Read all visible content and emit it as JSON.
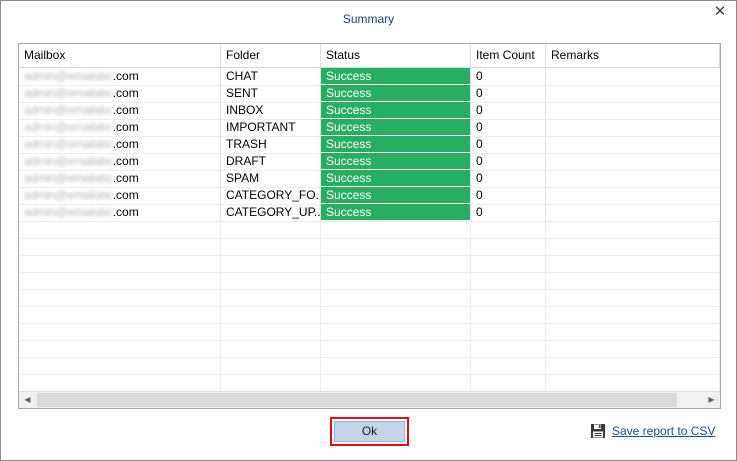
{
  "window": {
    "title": "Summary",
    "close_glyph": "✕"
  },
  "table": {
    "columns": [
      "Mailbox",
      "Folder",
      "Status",
      "Item Count",
      "Remarks"
    ],
    "rows": [
      {
        "mailbox_user": "admin@emailabc",
        "mailbox_domain": ".com",
        "folder": "CHAT",
        "status": "Success",
        "count": "0",
        "remarks": ""
      },
      {
        "mailbox_user": "admin@emailabc",
        "mailbox_domain": ".com",
        "folder": "SENT",
        "status": "Success",
        "count": "0",
        "remarks": ""
      },
      {
        "mailbox_user": "admin@emailabc",
        "mailbox_domain": ".com",
        "folder": "INBOX",
        "status": "Success",
        "count": "0",
        "remarks": ""
      },
      {
        "mailbox_user": "admin@emailabc",
        "mailbox_domain": ".com",
        "folder": "IMPORTANT",
        "status": "Success",
        "count": "0",
        "remarks": ""
      },
      {
        "mailbox_user": "admin@emailabc",
        "mailbox_domain": ".com",
        "folder": "TRASH",
        "status": "Success",
        "count": "0",
        "remarks": ""
      },
      {
        "mailbox_user": "admin@emailabc",
        "mailbox_domain": ".com",
        "folder": "DRAFT",
        "status": "Success",
        "count": "0",
        "remarks": ""
      },
      {
        "mailbox_user": "admin@emailabc",
        "mailbox_domain": ".com",
        "folder": "SPAM",
        "status": "Success",
        "count": "0",
        "remarks": ""
      },
      {
        "mailbox_user": "admin@emailabc",
        "mailbox_domain": ".com",
        "folder": "CATEGORY_FO...",
        "status": "Success",
        "count": "0",
        "remarks": ""
      },
      {
        "mailbox_user": "admin@emailabc",
        "mailbox_domain": ".com",
        "folder": "CATEGORY_UP...",
        "status": "Success",
        "count": "0",
        "remarks": ""
      }
    ],
    "status_color": "#27ae60",
    "scroll_left_glyph": "◀",
    "scroll_right_glyph": "▶"
  },
  "footer": {
    "ok_label": "Ok",
    "save_label": "Save report to CSV",
    "save_icon": "floppy-disk-icon",
    "highlight_color": "#e0101b"
  }
}
